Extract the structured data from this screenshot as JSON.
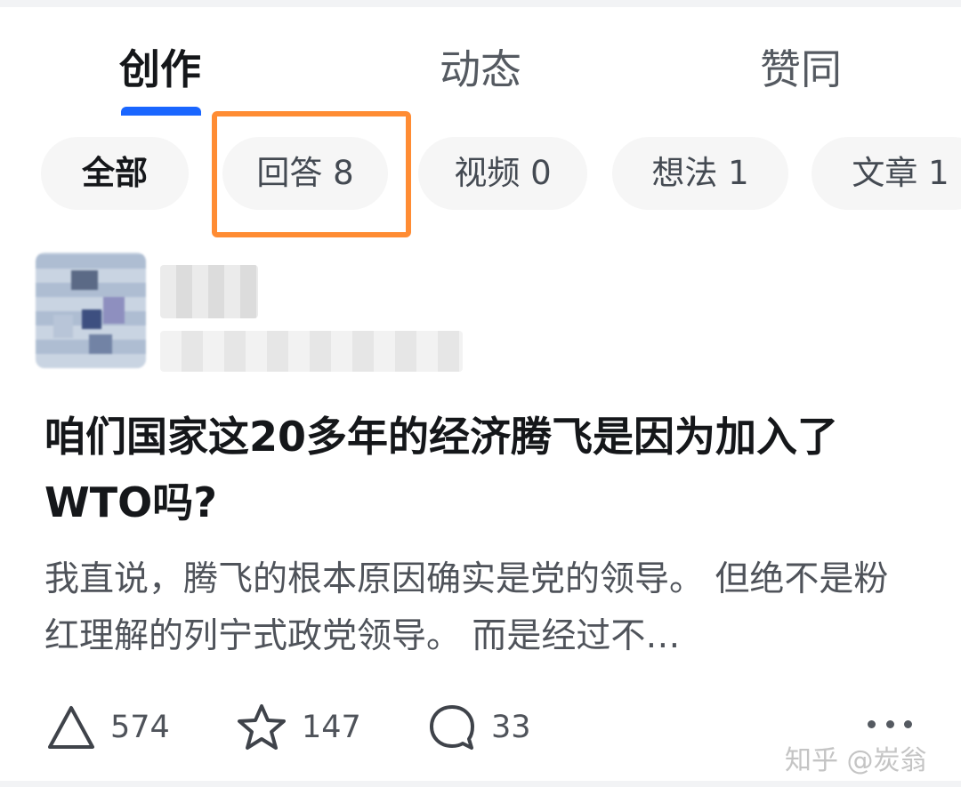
{
  "tabs": [
    {
      "label": "创作",
      "active": true
    },
    {
      "label": "动态",
      "active": false
    },
    {
      "label": "赞同",
      "active": false
    }
  ],
  "filters": [
    {
      "label": "全部",
      "active": true
    },
    {
      "label": "回答 8",
      "active": false,
      "highlighted": true
    },
    {
      "label": "视频 0",
      "active": false
    },
    {
      "label": "想法 1",
      "active": false
    },
    {
      "label": "文章 1",
      "active": false
    }
  ],
  "post": {
    "title": "咱们国家这20多年的经济腾飞是因为加入了WTO吗?",
    "excerpt": "我直说，腾飞的根本原因确实是党的领导。 但绝不是粉红理解的列宁式政党领导。 而是经过不…",
    "actions": {
      "upvote_count": "574",
      "favorite_count": "147",
      "comment_count": "33"
    },
    "icons": {
      "upvote": "upvote-triangle-icon",
      "favorite": "star-icon",
      "comment": "comment-bubble-icon",
      "more": "more-dots-icon"
    }
  },
  "watermark": "知乎 @炭翁",
  "colors": {
    "accent": "#1a66ff",
    "highlight_box": "#ff8c33",
    "pill_bg": "#f6f6f6"
  }
}
